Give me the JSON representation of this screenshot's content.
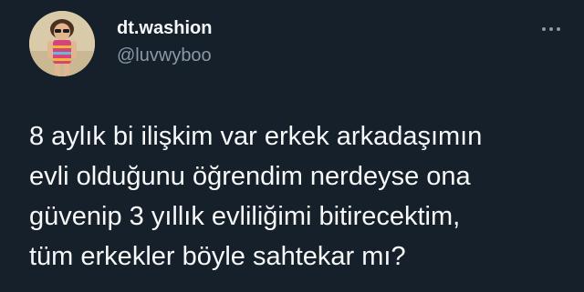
{
  "tweet": {
    "author": {
      "display_name": "dt.washion",
      "handle": "@luvwyboo",
      "avatar_icon": "profile-photo-icon"
    },
    "more_icon": "more-options-icon",
    "text_lines": [
      "8 aylık bi ilişkim var erkek arkadaşımın",
      "evli olduğunu öğrendim nerdeyse ona",
      "güvenip 3 yıllık evliliğimi bitirecektim,",
      "tüm erkekler böyle sahtekar mı?"
    ]
  },
  "colors": {
    "background": "#15202b",
    "primary_text": "#f7f9f9",
    "secondary_text": "#8b98a5"
  }
}
